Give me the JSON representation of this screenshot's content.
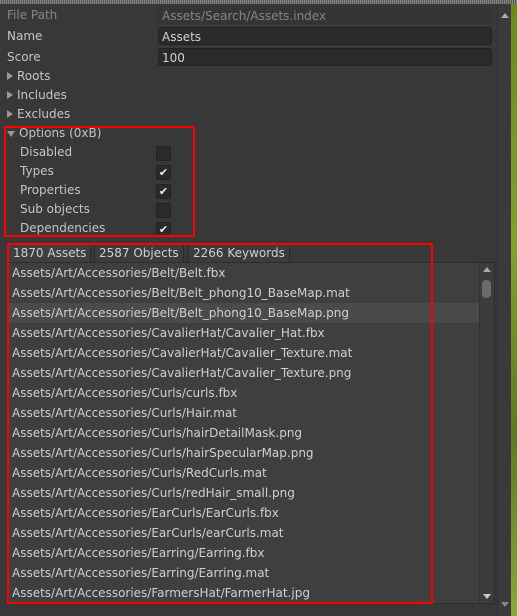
{
  "header": {
    "file_path_label": "File Path",
    "file_path_value": "Assets/Search/Assets.index",
    "name_label": "Name",
    "name_value": "Assets",
    "score_label": "Score",
    "score_value": "100"
  },
  "foldouts": [
    {
      "label": "Roots",
      "expanded": false
    },
    {
      "label": "Includes",
      "expanded": false
    },
    {
      "label": "Excludes",
      "expanded": false
    }
  ],
  "options": {
    "label": "Options (0xB)",
    "expanded": true,
    "items": [
      {
        "label": "Disabled",
        "checked": false
      },
      {
        "label": "Types",
        "checked": true
      },
      {
        "label": "Properties",
        "checked": true
      },
      {
        "label": "Sub objects",
        "checked": false
      },
      {
        "label": "Dependencies",
        "checked": true
      }
    ]
  },
  "tabs": [
    "1870 Assets",
    "2587 Objects",
    "2266 Keywords"
  ],
  "active_tab": 0,
  "selected_index": 2,
  "assets": [
    "Assets/Art/Accessories/Belt/Belt.fbx",
    "Assets/Art/Accessories/Belt/Belt_phong10_BaseMap.mat",
    "Assets/Art/Accessories/Belt/Belt_phong10_BaseMap.png",
    "Assets/Art/Accessories/CavalierHat/Cavalier_Hat.fbx",
    "Assets/Art/Accessories/CavalierHat/Cavalier_Texture.mat",
    "Assets/Art/Accessories/CavalierHat/Cavalier_Texture.png",
    "Assets/Art/Accessories/Curls/curls.fbx",
    "Assets/Art/Accessories/Curls/Hair.mat",
    "Assets/Art/Accessories/Curls/hairDetailMask.png",
    "Assets/Art/Accessories/Curls/hairSpecularMap.png",
    "Assets/Art/Accessories/Curls/RedCurls.mat",
    "Assets/Art/Accessories/Curls/redHair_small.png",
    "Assets/Art/Accessories/EarCurls/EarCurls.fbx",
    "Assets/Art/Accessories/EarCurls/earCurls.mat",
    "Assets/Art/Accessories/Earring/Earring.fbx",
    "Assets/Art/Accessories/Earring/Earring.mat",
    "Assets/Art/Accessories/FarmersHat/FarmerHat.jpg"
  ],
  "colors": {
    "highlight": "#ff0000",
    "background": "#383838"
  }
}
